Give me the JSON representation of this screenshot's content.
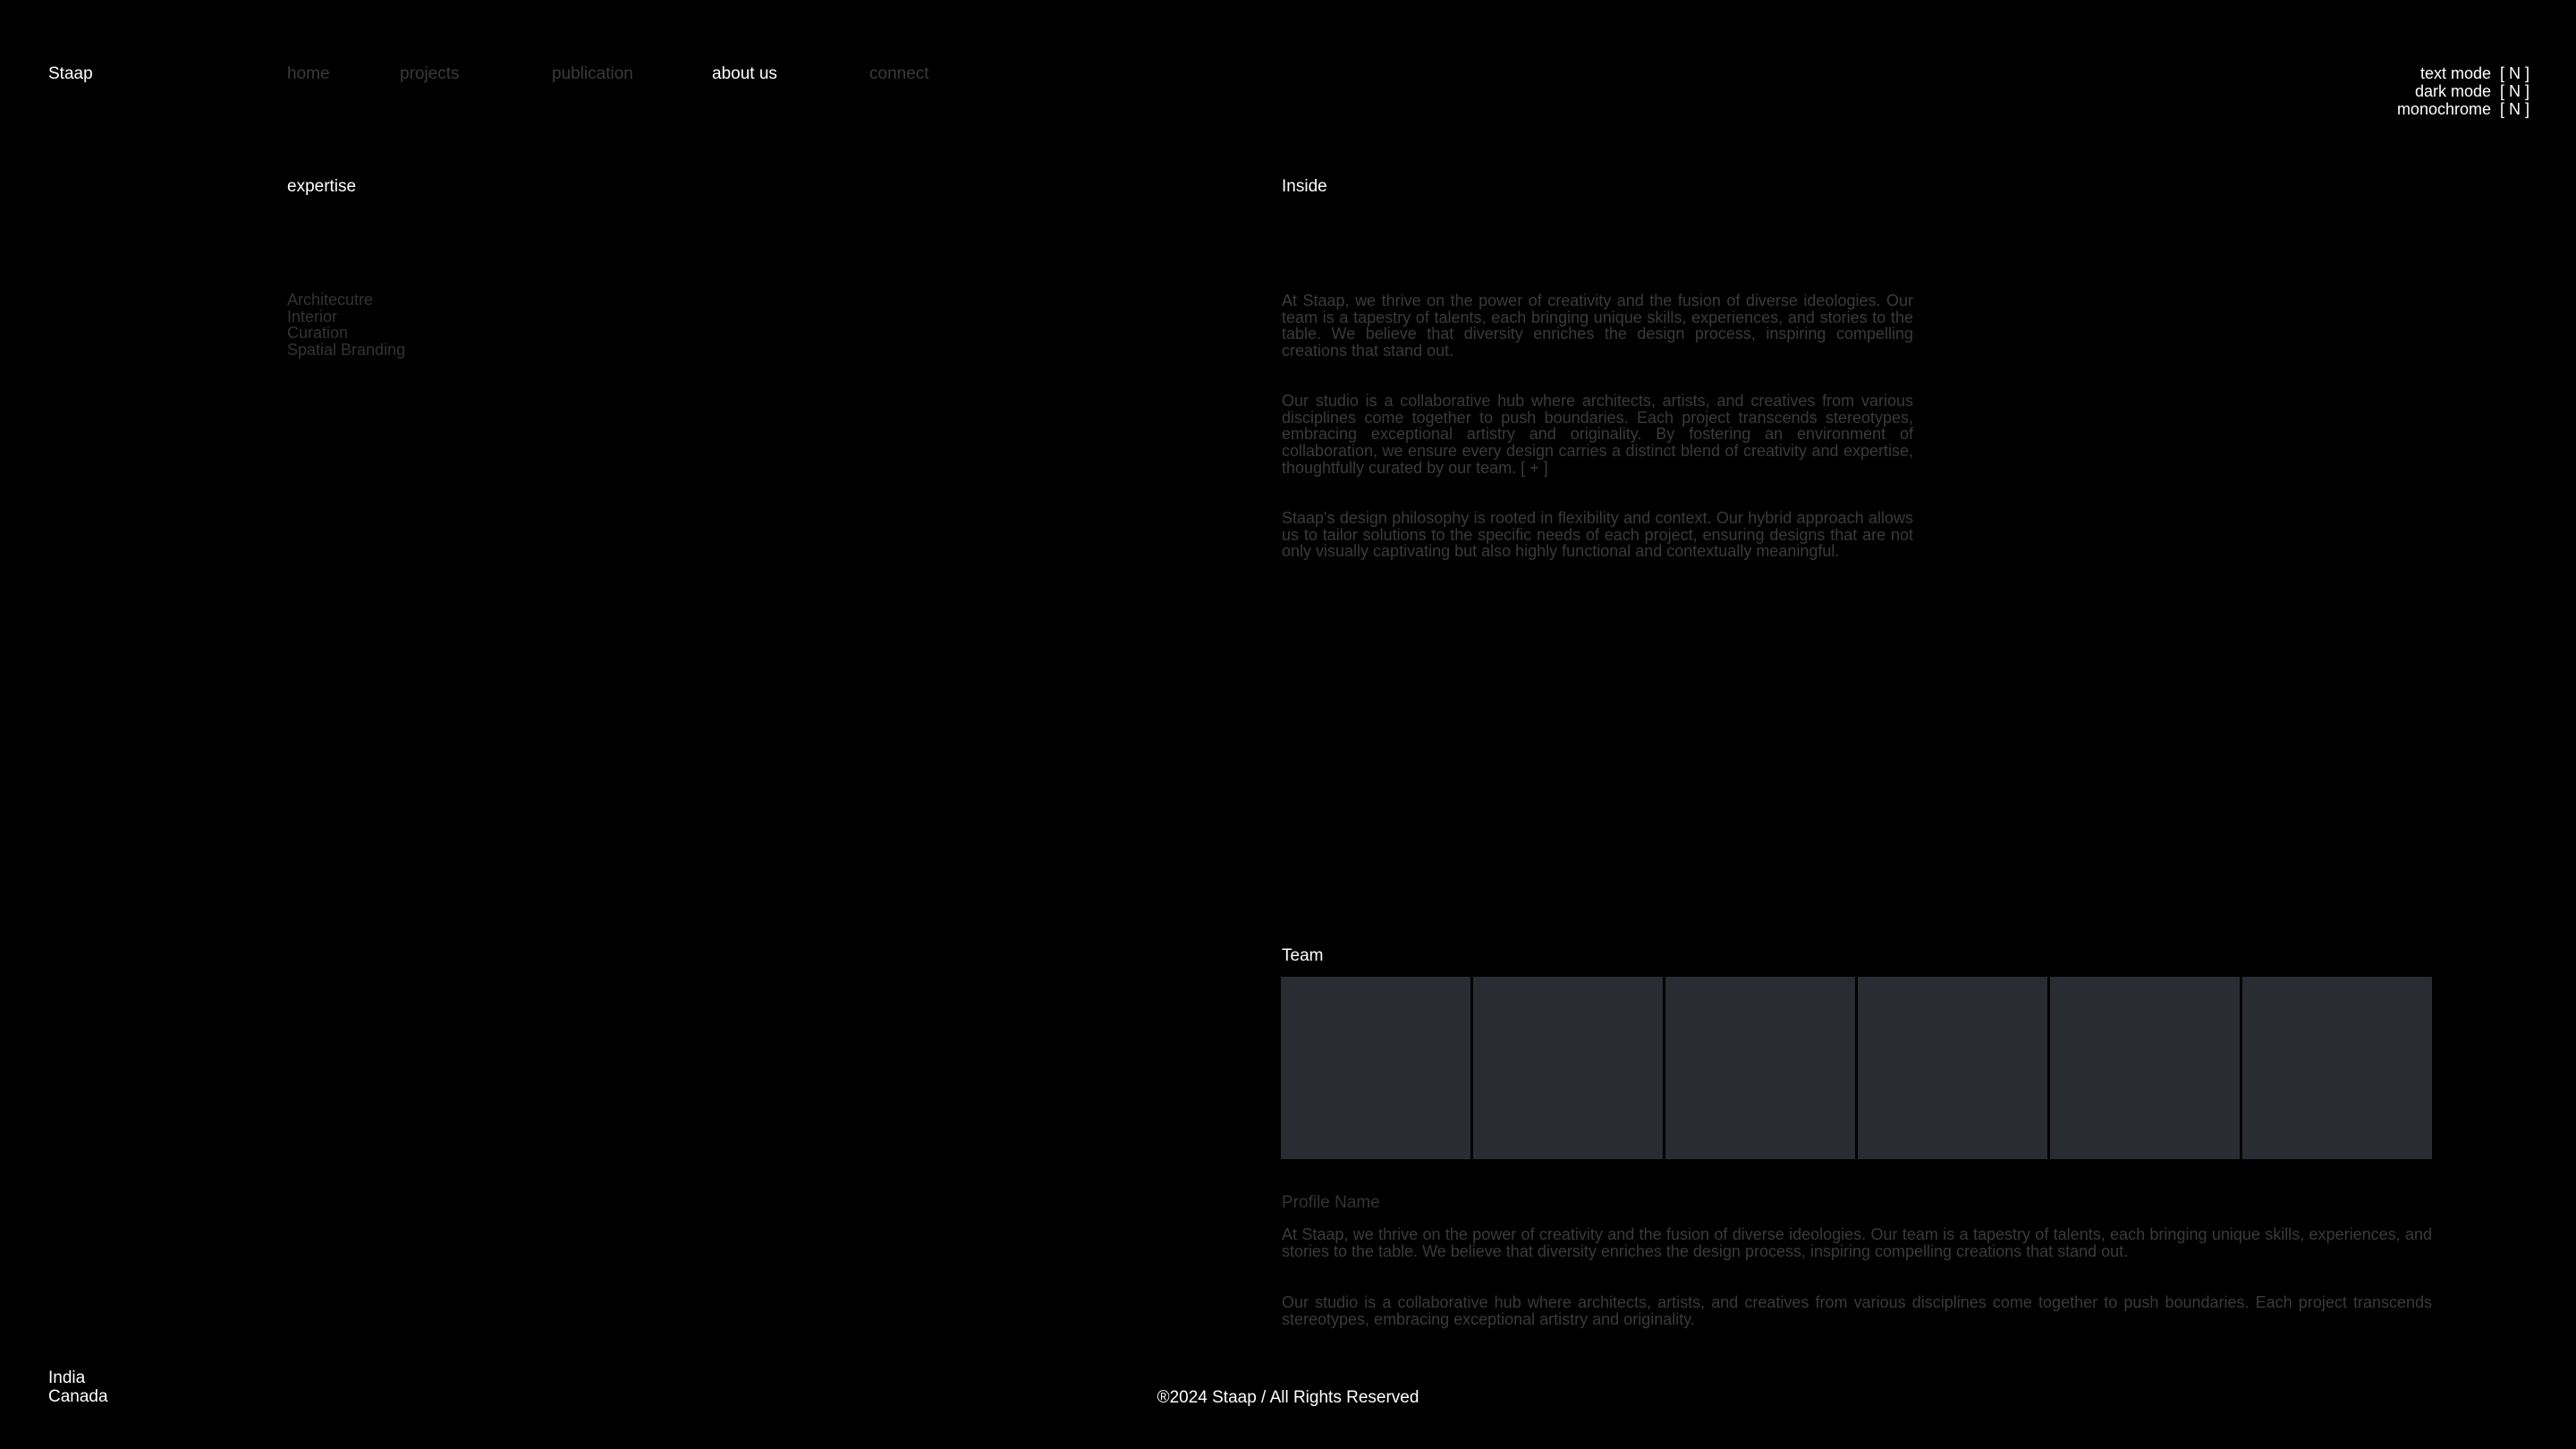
{
  "header": {
    "logo": "Staap",
    "nav": [
      {
        "label": "home",
        "active": false
      },
      {
        "label": "projects",
        "active": false
      },
      {
        "label": "publication",
        "active": false
      },
      {
        "label": "about us",
        "active": true
      },
      {
        "label": "connect",
        "active": false
      }
    ],
    "toggles": [
      {
        "label": "text mode",
        "state": "[ N ]"
      },
      {
        "label": "dark mode",
        "state": "[ N ]"
      },
      {
        "label": "monochrome",
        "state": "[ N ]"
      }
    ]
  },
  "expertise": {
    "heading": "expertise",
    "items": [
      "Architecutre",
      "Interior",
      "Curation",
      "Spatial Branding"
    ]
  },
  "inside": {
    "heading": "Inside",
    "paragraphs": [
      "At Staap, we thrive on the power of creativity and the fusion of diverse ideologies. Our team is a tapestry of talents, each bringing unique skills, experiences, and stories to the table. We believe that diversity enriches the design process, inspiring compelling creations that stand out.",
      "Our studio is a collaborative hub where architects, artists, and creatives from various disciplines come together to push boundaries. Each project transcends stereotypes, embracing exceptional artistry and originality. By fostering an environment of collaboration, we ensure every design carries a distinct blend of creativity and expertise, thoughtfully curated by our team. [ + ]",
      "Staap's design philosophy is rooted in flexibility and context. Our hybrid approach allows us to tailor solutions to the specific needs of each project, ensuring designs that are not only visually captivating but also highly functional and contextually meaningful."
    ]
  },
  "team": {
    "heading": "Team",
    "card_count": 6,
    "card_color": "#2a2c33",
    "profile_name": "Profile Name",
    "profile_paragraphs": [
      "At Staap, we thrive on the power of creativity and the fusion of diverse ideologies. Our team is a tapestry of talents, each bringing unique skills, experiences, and stories to the table. We believe that diversity enriches the design process, inspiring compelling creations that stand out.",
      "Our studio is a collaborative hub where architects, artists, and creatives from various disciplines come together to push boundaries. Each project transcends stereotypes, embracing exceptional artistry and originality."
    ]
  },
  "footer": {
    "locations": [
      "India",
      "Canada"
    ],
    "copyright": "®2024 Staap / All Rights Reserved"
  },
  "colors": {
    "background": "#000000",
    "text_primary": "#ffffff",
    "text_muted": "#3a3a3a"
  }
}
